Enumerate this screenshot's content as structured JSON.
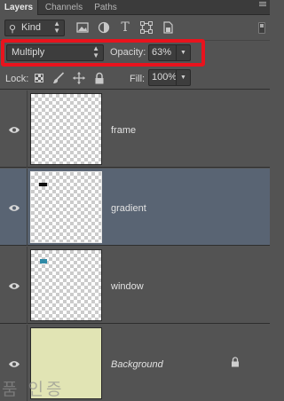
{
  "tabs": [
    {
      "label": "Layers",
      "active": true
    },
    {
      "label": "Channels",
      "active": false
    },
    {
      "label": "Paths",
      "active": false
    }
  ],
  "filter": {
    "kind_label": "Kind",
    "icons": [
      "image-filter-icon",
      "adjustment-filter-icon",
      "type-filter-icon",
      "shape-filter-icon",
      "smart-object-filter-icon"
    ]
  },
  "blend": {
    "mode": "Multiply",
    "opacity_label": "Opacity:",
    "opacity_value": "63%",
    "highlight_color": "#e8131d"
  },
  "lock": {
    "label": "Lock:",
    "icons": [
      "lock-transparent-icon",
      "lock-pixels-icon",
      "lock-position-icon",
      "lock-all-icon"
    ],
    "fill_label": "Fill:",
    "fill_value": "100%"
  },
  "layers": [
    {
      "name": "frame",
      "visible": true,
      "selected": false,
      "italic": false
    },
    {
      "name": "gradient",
      "visible": true,
      "selected": true,
      "italic": false,
      "mark_color": "#111111"
    },
    {
      "name": "window",
      "visible": true,
      "selected": false,
      "italic": false,
      "mark_color": "#2f8aa6"
    },
    {
      "name": "Background",
      "visible": true,
      "selected": false,
      "italic": true,
      "locked": true,
      "fill_color": "#e1e4b4"
    }
  ],
  "colors": {
    "panel_bg": "#535353",
    "selected_row": "#596473"
  },
  "watermark": "품 인증"
}
